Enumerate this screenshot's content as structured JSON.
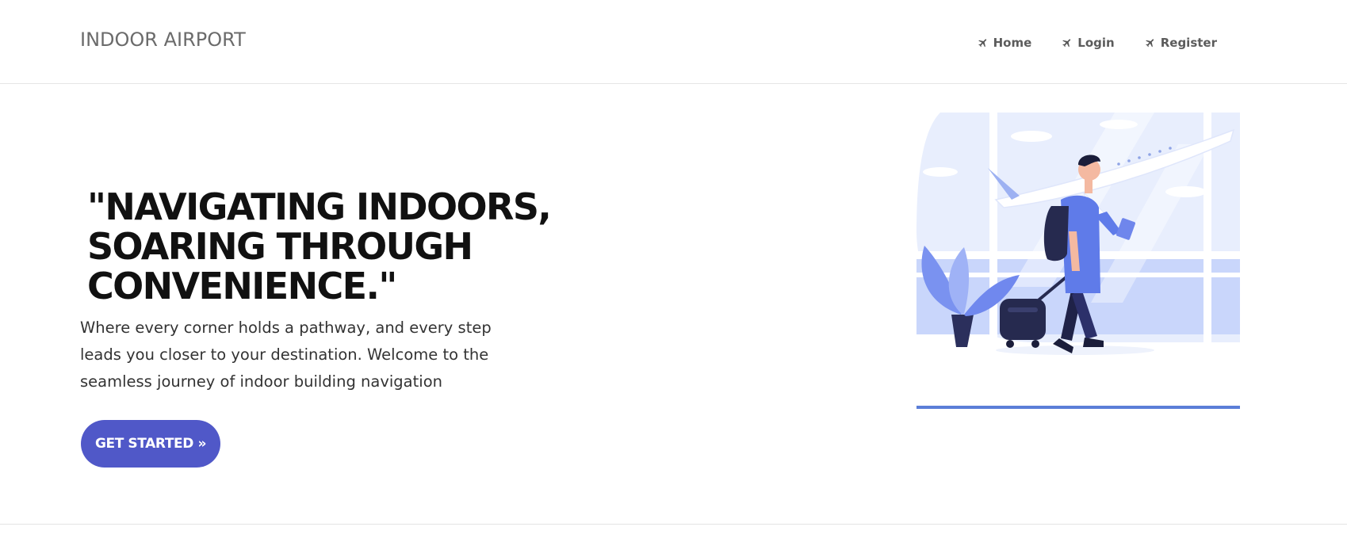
{
  "navbar": {
    "brand": "INDOOR AIRPORT",
    "links": [
      {
        "label": "Home",
        "icon": "plane-icon"
      },
      {
        "label": "Login",
        "icon": "plane-icon"
      },
      {
        "label": "Register",
        "icon": "plane-icon"
      }
    ]
  },
  "hero": {
    "title_lines": [
      "\"NAVIGATING INDOORS,",
      "SOARING THROUGH",
      "CONVENIENCE.\""
    ],
    "subtitle": "Where every corner holds a pathway, and every step leads you closer to your destination. Welcome to the seamless journey of indoor building navigation",
    "cta_label": "GET STARTED »",
    "illustration": "traveler-with-suitcase-airport-illustration"
  },
  "colors": {
    "accent": "#5058c8",
    "underline": "#5b7ed8",
    "illustration_blue": "#6f86ec",
    "text_dark": "#111111",
    "nav_text": "#5c5c5c"
  }
}
